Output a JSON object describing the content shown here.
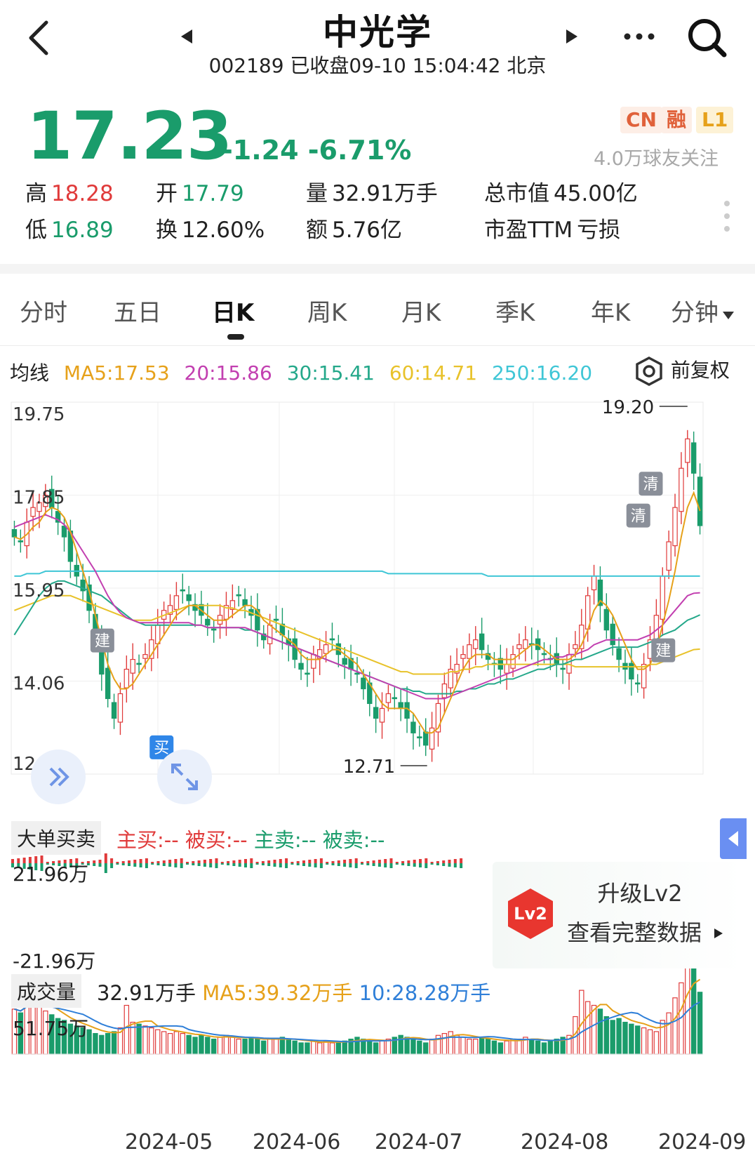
{
  "header": {
    "title": "中光学",
    "subtitle": "002189 已收盘09-10 15:04:42 北京"
  },
  "quote": {
    "price": "17.23",
    "change": "-1.24",
    "change_pct": "-6.71%",
    "badges": [
      "CN",
      "融",
      "L1"
    ],
    "followers": "4.0万球友关注",
    "stats": {
      "high_label": "高",
      "high": "18.28",
      "open_label": "开",
      "open": "17.79",
      "vol_label": "量",
      "vol": "32.91万手",
      "mcap_label": "总市值",
      "mcap": "45.00亿",
      "low_label": "低",
      "low": "16.89",
      "turnover_label": "换",
      "turnover": "12.60%",
      "amount_label": "额",
      "amount": "5.76亿",
      "pe_label": "市盈TTM",
      "pe": "亏损"
    }
  },
  "tabs": [
    "分时",
    "五日",
    "日K",
    "周K",
    "月K",
    "季K",
    "年K",
    "分钟"
  ],
  "active_tab": 2,
  "ma": {
    "label": "均线",
    "ma5": "MA5:17.53",
    "ma20": "20:15.86",
    "ma30": "30:15.41",
    "ma60": "60:14.71",
    "ma250": "250:16.20",
    "adjust": "前复权",
    "colors": {
      "ma5": "#e6a11a",
      "ma20": "#c23fb0",
      "ma30": "#24a88a",
      "ma60": "#e8c22a",
      "ma250": "#3fc6d6",
      "up": "#e03a3a",
      "down": "#1a9c6b"
    }
  },
  "chart_data": {
    "type": "candlestick",
    "x_ticks": [
      "2024-05",
      "2024-06",
      "2024-07",
      "2024-08",
      "2024-09"
    ],
    "y_ticks": [
      "19.75",
      "17.85",
      "15.95",
      "14.06",
      "12.16"
    ],
    "ylim": [
      12.16,
      19.75
    ],
    "high_marker": "19.20",
    "low_marker": "12.71",
    "signals": [
      "建",
      "买",
      "清",
      "清",
      "建"
    ],
    "closes": [
      17.0,
      16.9,
      17.3,
      17.6,
      17.7,
      17.85,
      17.6,
      17.3,
      17.0,
      16.5,
      16.2,
      15.9,
      15.5,
      15.0,
      14.2,
      13.7,
      13.3,
      13.8,
      14.3,
      14.5,
      14.4,
      14.6,
      14.9,
      15.2,
      15.5,
      15.6,
      15.8,
      15.9,
      15.7,
      15.5,
      15.4,
      15.2,
      15.1,
      15.4,
      15.6,
      15.7,
      15.8,
      15.6,
      15.4,
      15.1,
      14.9,
      15.2,
      15.3,
      15.0,
      14.8,
      14.5,
      14.3,
      14.2,
      14.6,
      14.7,
      14.8,
      14.9,
      14.6,
      14.4,
      14.3,
      14.2,
      13.9,
      13.6,
      13.3,
      13.5,
      13.8,
      13.7,
      13.5,
      13.3,
      13.0,
      12.9,
      12.75,
      13.1,
      13.6,
      14.0,
      14.3,
      14.4,
      14.6,
      14.8,
      14.9,
      14.7,
      14.5,
      14.4,
      14.3,
      14.4,
      14.6,
      14.8,
      14.9,
      14.8,
      14.7,
      14.6,
      14.5,
      14.4,
      14.3,
      14.6,
      14.8,
      15.2,
      15.8,
      16.2,
      15.6,
      15.1,
      14.8,
      14.5,
      14.3,
      14.1,
      14.0,
      14.4,
      14.9,
      15.4,
      16.2,
      16.9,
      17.6,
      18.4,
      19.0,
      18.3,
      17.23
    ],
    "ma5": [
      17.0,
      16.95,
      17.05,
      17.2,
      17.3,
      17.5,
      17.6,
      17.55,
      17.4,
      17.1,
      16.7,
      16.3,
      15.9,
      15.4,
      14.9,
      14.4,
      14.1,
      13.9,
      13.9,
      14.0,
      14.2,
      14.4,
      14.6,
      14.8,
      15.0,
      15.2,
      15.4,
      15.5,
      15.6,
      15.6,
      15.5,
      15.4,
      15.3,
      15.3,
      15.3,
      15.4,
      15.5,
      15.6,
      15.6,
      15.5,
      15.3,
      15.2,
      15.1,
      15.0,
      14.9,
      14.8,
      14.6,
      14.5,
      14.5,
      14.5,
      14.6,
      14.7,
      14.7,
      14.6,
      14.5,
      14.4,
      14.2,
      14.0,
      13.8,
      13.6,
      13.5,
      13.5,
      13.5,
      13.5,
      13.4,
      13.2,
      13.0,
      13.0,
      13.1,
      13.4,
      13.7,
      14.0,
      14.3,
      14.5,
      14.6,
      14.6,
      14.6,
      14.5,
      14.5,
      14.5,
      14.5,
      14.6,
      14.7,
      14.8,
      14.8,
      14.7,
      14.6,
      14.5,
      14.5,
      14.5,
      14.6,
      14.8,
      15.1,
      15.5,
      15.7,
      15.6,
      15.4,
      15.1,
      14.8,
      14.5,
      14.3,
      14.3,
      14.4,
      14.7,
      15.2,
      15.7,
      16.3,
      17.0,
      17.6,
      17.9,
      17.53
    ],
    "ma20": [
      17.2,
      17.25,
      17.3,
      17.35,
      17.4,
      17.45,
      17.4,
      17.35,
      17.25,
      17.1,
      16.9,
      16.7,
      16.5,
      16.3,
      16.05,
      15.8,
      15.6,
      15.45,
      15.35,
      15.3,
      15.25,
      15.25,
      15.25,
      15.25,
      15.25,
      15.25,
      15.25,
      15.25,
      15.25,
      15.2,
      15.2,
      15.15,
      15.15,
      15.15,
      15.15,
      15.15,
      15.15,
      15.15,
      15.1,
      15.05,
      15.0,
      14.95,
      14.9,
      14.85,
      14.8,
      14.75,
      14.7,
      14.65,
      14.6,
      14.55,
      14.5,
      14.45,
      14.4,
      14.35,
      14.3,
      14.25,
      14.2,
      14.15,
      14.1,
      14.05,
      14.0,
      13.95,
      13.9,
      13.85,
      13.8,
      13.75,
      13.7,
      13.7,
      13.7,
      13.7,
      13.75,
      13.8,
      13.85,
      13.9,
      13.95,
      14.0,
      14.05,
      14.1,
      14.15,
      14.2,
      14.25,
      14.3,
      14.35,
      14.4,
      14.45,
      14.5,
      14.5,
      14.55,
      14.55,
      14.6,
      14.6,
      14.65,
      14.7,
      14.8,
      14.85,
      14.9,
      14.9,
      14.9,
      14.9,
      14.9,
      14.9,
      14.95,
      15.0,
      15.1,
      15.2,
      15.35,
      15.5,
      15.65,
      15.8,
      15.85,
      15.86
    ],
    "ma30": [
      15.0,
      15.2,
      15.4,
      15.6,
      15.8,
      15.95,
      16.05,
      16.1,
      16.1,
      16.05,
      16.0,
      15.95,
      15.9,
      15.85,
      15.8,
      15.7,
      15.6,
      15.5,
      15.4,
      15.3,
      15.25,
      15.2,
      15.2,
      15.2,
      15.2,
      15.2,
      15.2,
      15.2,
      15.2,
      15.2,
      15.2,
      15.15,
      15.15,
      15.15,
      15.15,
      15.15,
      15.15,
      15.1,
      15.1,
      15.05,
      15.0,
      14.95,
      14.9,
      14.85,
      14.8,
      14.75,
      14.7,
      14.65,
      14.6,
      14.55,
      14.5,
      14.45,
      14.4,
      14.35,
      14.3,
      14.25,
      14.2,
      14.15,
      14.1,
      14.05,
      14.0,
      13.95,
      13.9,
      13.9,
      13.85,
      13.85,
      13.8,
      13.8,
      13.8,
      13.8,
      13.8,
      13.85,
      13.85,
      13.9,
      13.9,
      13.95,
      14.0,
      14.0,
      14.05,
      14.1,
      14.1,
      14.15,
      14.2,
      14.25,
      14.3,
      14.3,
      14.35,
      14.4,
      14.4,
      14.45,
      14.5,
      14.5,
      14.55,
      14.6,
      14.65,
      14.7,
      14.75,
      14.75,
      14.75,
      14.75,
      14.75,
      14.8,
      14.85,
      14.9,
      15.0,
      15.05,
      15.1,
      15.2,
      15.3,
      15.35,
      15.41
    ],
    "ma60": [
      15.5,
      15.55,
      15.6,
      15.65,
      15.7,
      15.75,
      15.8,
      15.8,
      15.8,
      15.8,
      15.75,
      15.7,
      15.65,
      15.6,
      15.55,
      15.5,
      15.45,
      15.4,
      15.35,
      15.3,
      15.3,
      15.3,
      15.3,
      15.35,
      15.4,
      15.45,
      15.5,
      15.55,
      15.6,
      15.6,
      15.6,
      15.6,
      15.6,
      15.6,
      15.55,
      15.55,
      15.5,
      15.5,
      15.45,
      15.4,
      15.35,
      15.3,
      15.25,
      15.2,
      15.15,
      15.1,
      15.05,
      15.0,
      14.95,
      14.9,
      14.85,
      14.8,
      14.75,
      14.7,
      14.65,
      14.6,
      14.55,
      14.5,
      14.45,
      14.4,
      14.35,
      14.3,
      14.25,
      14.25,
      14.2,
      14.2,
      14.2,
      14.2,
      14.2,
      14.2,
      14.25,
      14.25,
      14.3,
      14.3,
      14.35,
      14.35,
      14.4,
      14.4,
      14.4,
      14.4,
      14.4,
      14.4,
      14.4,
      14.4,
      14.4,
      14.4,
      14.4,
      14.4,
      14.4,
      14.4,
      14.35,
      14.35,
      14.35,
      14.35,
      14.35,
      14.35,
      14.35,
      14.35,
      14.35,
      14.35,
      14.35,
      14.35,
      14.4,
      14.4,
      14.45,
      14.5,
      14.55,
      14.6,
      14.65,
      14.7,
      14.71
    ],
    "ma250": [
      16.2,
      16.2,
      16.25,
      16.25,
      16.25,
      16.3,
      16.3,
      16.3,
      16.3,
      16.3,
      16.3,
      16.3,
      16.3,
      16.3,
      16.3,
      16.3,
      16.3,
      16.3,
      16.3,
      16.3,
      16.3,
      16.3,
      16.3,
      16.3,
      16.3,
      16.3,
      16.3,
      16.3,
      16.3,
      16.3,
      16.3,
      16.3,
      16.3,
      16.3,
      16.3,
      16.3,
      16.3,
      16.3,
      16.3,
      16.3,
      16.3,
      16.3,
      16.3,
      16.3,
      16.3,
      16.3,
      16.3,
      16.3,
      16.3,
      16.3,
      16.3,
      16.3,
      16.3,
      16.3,
      16.3,
      16.3,
      16.3,
      16.3,
      16.3,
      16.3,
      16.25,
      16.25,
      16.25,
      16.25,
      16.25,
      16.25,
      16.25,
      16.25,
      16.25,
      16.25,
      16.25,
      16.25,
      16.25,
      16.25,
      16.25,
      16.25,
      16.2,
      16.2,
      16.2,
      16.2,
      16.2,
      16.2,
      16.2,
      16.2,
      16.2,
      16.2,
      16.2,
      16.2,
      16.2,
      16.2,
      16.2,
      16.2,
      16.2,
      16.2,
      16.2,
      16.2,
      16.2,
      16.2,
      16.2,
      16.2,
      16.2,
      16.2,
      16.2,
      16.2,
      16.2,
      16.2,
      16.2,
      16.2,
      16.2,
      16.2,
      16.2
    ]
  },
  "large_orders": {
    "label": "大单买卖",
    "main_buy": "主买:--",
    "passive_buy": "被买:--",
    "main_sell": "主卖:--",
    "passive_sell": "被卖:--",
    "y_max": "21.96万",
    "y_min": "-21.96万",
    "upgrade_line1": "升级Lv2",
    "upgrade_line2": "查看完整数据",
    "lv2_badge": "Lv2"
  },
  "volume": {
    "label": "成交量",
    "current": "32.91万手",
    "ma5": "MA5:39.32万手",
    "ma10": "10:28.28万手",
    "y_max": "51.75万",
    "values": [
      24,
      22,
      30,
      29,
      27,
      23,
      21,
      19,
      18,
      16,
      15,
      14,
      13,
      11,
      10,
      11,
      12,
      14,
      26,
      17,
      16,
      15,
      14,
      13,
      12,
      11,
      12,
      11,
      10,
      9,
      10,
      9,
      8,
      9,
      10,
      9,
      8,
      8,
      9,
      8,
      7,
      8,
      8,
      9,
      8,
      7,
      6,
      6,
      7,
      6,
      7,
      6,
      6,
      7,
      8,
      9,
      8,
      7,
      6,
      7,
      8,
      9,
      10,
      9,
      8,
      7,
      6,
      8,
      10,
      11,
      12,
      10,
      9,
      8,
      8,
      9,
      8,
      7,
      6,
      7,
      8,
      8,
      9,
      8,
      7,
      6,
      7,
      8,
      9,
      10,
      20,
      34,
      28,
      26,
      24,
      20,
      18,
      19,
      17,
      16,
      15,
      14,
      13,
      12,
      18,
      22,
      30,
      38,
      52,
      46,
      33
    ]
  }
}
